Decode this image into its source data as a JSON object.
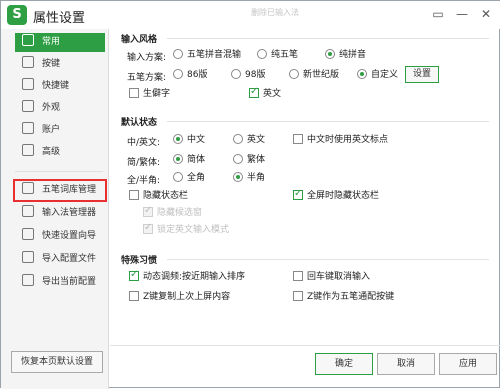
{
  "window": {
    "title": "属性设置",
    "faded_title": "删除已输入法"
  },
  "sidebar": {
    "items": [
      {
        "label": "常用",
        "icon": "general-icon"
      },
      {
        "label": "按键",
        "icon": "key-icon"
      },
      {
        "label": "快捷键",
        "icon": "shortcut-icon"
      },
      {
        "label": "外观",
        "icon": "appearance-icon"
      },
      {
        "label": "账户",
        "icon": "account-icon"
      },
      {
        "label": "高级",
        "icon": "advanced-icon"
      }
    ],
    "tools": [
      {
        "label": "五笔词库管理",
        "icon": "dictionary-icon"
      },
      {
        "label": "输入法管理器",
        "icon": "ime-manager-icon"
      },
      {
        "label": "快速设置向导",
        "icon": "wizard-icon"
      },
      {
        "label": "导入配置文件",
        "icon": "import-icon"
      },
      {
        "label": "导出当前配置",
        "icon": "export-icon"
      }
    ],
    "restore_label": "恢复本页默认设置"
  },
  "input_style": {
    "heading": "输入风格",
    "scheme_label": "输入方案:",
    "schemes": [
      "五笔拼音混输",
      "纯五笔",
      "纯拼音"
    ],
    "wubi_label": "五笔方案:",
    "wubi": [
      "86版",
      "98版",
      "新世纪版",
      "自定义"
    ],
    "settings_btn": "设置",
    "checks": [
      "生僻字",
      "英文"
    ]
  },
  "default_state": {
    "heading": "默认状态",
    "cn_en_label": "中/英文:",
    "cn_en": [
      "中文",
      "英文"
    ],
    "cn_en_check": "中文时使用英文标点",
    "simp_trad_label": "简/繁体:",
    "simp_trad": [
      "简体",
      "繁体"
    ],
    "width_label": "全/半角:",
    "width": [
      "全角",
      "半角"
    ],
    "hide_status": "隐藏状态栏",
    "fullscreen_hide": "全屏时隐藏状态栏",
    "disabled1": "隐藏候选窗",
    "disabled2": "锁定英文输入模式"
  },
  "special": {
    "heading": "特殊习惯",
    "dynamic": "动态调频:按近期输入排序",
    "recall": "回车键取消输入",
    "z_repeat": "Z键复制上次上屏内容",
    "z_key": "Z键作为五笔通配按键"
  },
  "footer": {
    "ok": "确定",
    "cancel": "取消",
    "apply": "应用"
  }
}
